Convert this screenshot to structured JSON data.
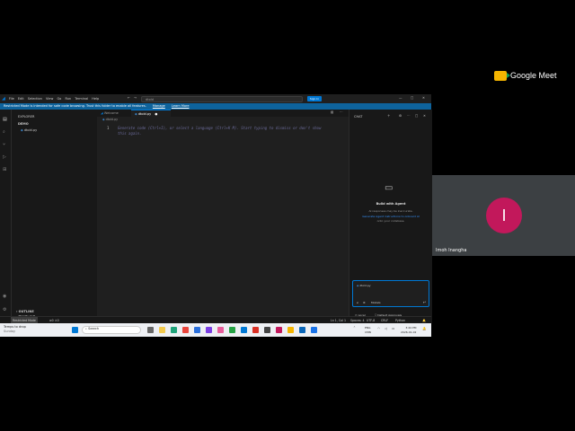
{
  "meet": {
    "brand": "Google Meet",
    "participant_initial": "I",
    "participant_name": "Imoh Inangha",
    "avatar_color": "#c2185b"
  },
  "vscode": {
    "menu": [
      "File",
      "Edit",
      "Selection",
      "View",
      "Go",
      "Run",
      "Terminal",
      "Help"
    ],
    "search_placeholder": "dtold",
    "signin_label": "Sign In",
    "banner_text": "Restricted Mode is intended for safe code browsing. Trust this folder to enable all features.",
    "banner_manage": "Manage",
    "banner_learn": "Learn More",
    "explorer_title": "EXPLORER",
    "folder_name": "DEMO",
    "file_name": "dtold.py",
    "outline_label": "OUTLINE",
    "timeline_label": "TIMELINE",
    "tabs": [
      {
        "label": "Welcome"
      },
      {
        "label": "dtold.py"
      }
    ],
    "breadcrumb": "dtold.py",
    "line_number": "1",
    "placeholder_line1": "Generate code (Ctrl+I), or select a language (Ctrl+K M). Start typing to dismiss or don't show",
    "placeholder_line2": "this again.",
    "chat": {
      "title": "CHAT",
      "heading": "Build with Agent",
      "sub1": "AI responses may be inaccurate.",
      "sub2": "Generate Agent instructions to onboard AI",
      "sub3": "onto your codebase.",
      "context_chip": "dtold.py",
      "mode": "Models",
      "agent_label": "Local",
      "approvals_label": "Default Approvals"
    },
    "status": {
      "restricted": "Restricted Mode",
      "errors": "0",
      "warnings": "0",
      "position": "Ln 1, Col 1",
      "spaces": "Spaces: 4",
      "encoding": "UTF-8",
      "eol": "CRLF",
      "language": "Python"
    }
  },
  "taskbar": {
    "weather": "Temps to drop",
    "weather_sub": "Sunday",
    "search_placeholder": "Search",
    "lang_top": "ENG",
    "lang_bottom": "CMN",
    "time": "3:44 PM",
    "date": "2026-01-02"
  },
  "colors": {
    "accent": "#0078d4",
    "banner": "#0e639c"
  }
}
